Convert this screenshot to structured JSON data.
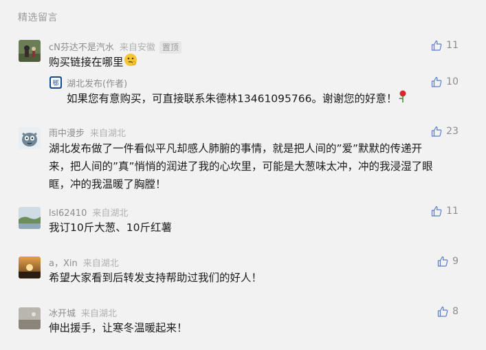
{
  "section_title": "精选留言",
  "comments": [
    {
      "nickname": "cN芬达不是汽水",
      "location": "来自安徽",
      "pinned_label": "置顶",
      "text": "购买链接在哪里",
      "likes": "11",
      "reply": {
        "author": "湖北发布(作者)",
        "text": "如果您有意购买，可直接联系朱德林13461095766。谢谢您的好意！",
        "likes": "10"
      }
    },
    {
      "nickname": "雨中漫步",
      "location": "来自湖北",
      "text_lines": [
        "湖北发布做了一件看似平凡却感人肺腑的事情，就是把人间的”爱”默默的传递开",
        "来，把人间的”真”悄悄的润进了我的心坎里，可能是大葱味太冲，冲的我浸湿了眼",
        "眶，冲的我温暖了胸膛！"
      ],
      "likes": "23"
    },
    {
      "nickname": "lsl62410",
      "location": "来自湖北",
      "text": "我订10斤大葱、10斤红薯",
      "likes": "11"
    },
    {
      "nickname": "a，Xin",
      "location": "来自湖北",
      "text": "希望大家看到后转发支持帮助过我们的好人！",
      "likes": "9"
    },
    {
      "nickname": "冰开城",
      "location": "来自湖北",
      "text": "伸出援手，让寒冬温暖起来！",
      "likes": "8"
    }
  ]
}
